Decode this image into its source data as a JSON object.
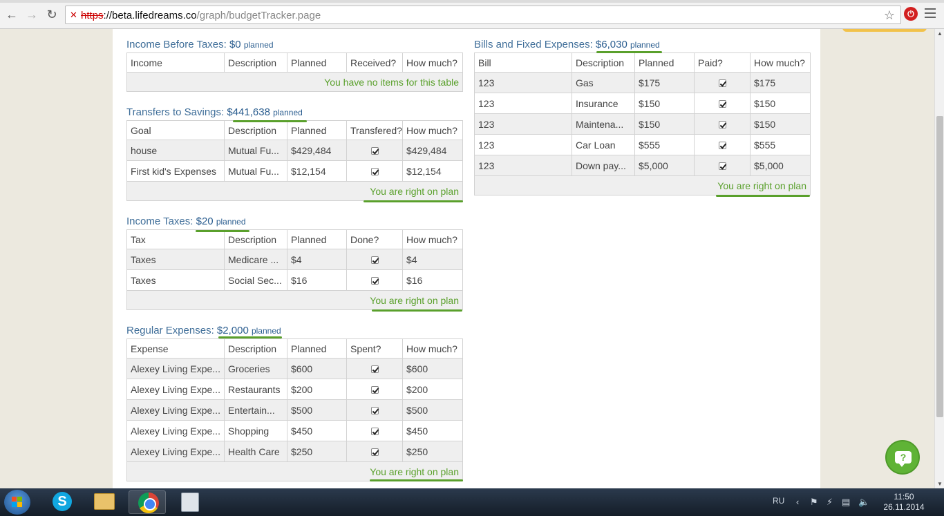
{
  "browser": {
    "url_scheme": "https",
    "url_host": "://beta.lifedreams.co",
    "url_path": "/graph/budgetTracker.page"
  },
  "sections": {
    "income": {
      "title": "Income Before Taxes: ",
      "amount": "$0",
      "planned": "planned",
      "headers": [
        "Income",
        "Description",
        "Planned",
        "Received?",
        "How much?"
      ],
      "rows": [],
      "footer": "You have no items for this table"
    },
    "savings": {
      "title": "Transfers to Savings: ",
      "amount": "$441,638",
      "planned": "planned",
      "headers": [
        "Goal",
        "Description",
        "Planned",
        "Transfered?",
        "How much?"
      ],
      "rows": [
        {
          "name": "house",
          "description": "Mutual Fu...",
          "planned": "$429,484",
          "checked": true,
          "how_much": "$429,484"
        },
        {
          "name": "First kid's Expenses",
          "description": "Mutual Fu...",
          "planned": "$12,154",
          "checked": true,
          "how_much": "$12,154"
        }
      ],
      "footer": "You are right on plan"
    },
    "taxes": {
      "title": "Income Taxes: ",
      "amount": "$20",
      "planned": "planned",
      "headers": [
        "Tax",
        "Description",
        "Planned",
        "Done?",
        "How much?"
      ],
      "rows": [
        {
          "name": "Taxes",
          "description": "Medicare ...",
          "planned": "$4",
          "checked": true,
          "how_much": "$4"
        },
        {
          "name": "Taxes",
          "description": "Social Sec...",
          "planned": "$16",
          "checked": true,
          "how_much": "$16"
        }
      ],
      "footer": "You are right on plan"
    },
    "expenses": {
      "title": "Regular Expenses: ",
      "amount": "$2,000",
      "planned": "planned",
      "headers": [
        "Expense",
        "Description",
        "Planned",
        "Spent?",
        "How much?"
      ],
      "rows": [
        {
          "name": "Alexey Living Expe...",
          "description": "Groceries",
          "planned": "$600",
          "checked": true,
          "how_much": "$600"
        },
        {
          "name": "Alexey Living Expe...",
          "description": "Restaurants",
          "planned": "$200",
          "checked": true,
          "how_much": "$200"
        },
        {
          "name": "Alexey Living Expe...",
          "description": "Entertain...",
          "planned": "$500",
          "checked": true,
          "how_much": "$500"
        },
        {
          "name": "Alexey Living Expe...",
          "description": "Shopping",
          "planned": "$450",
          "checked": true,
          "how_much": "$450"
        },
        {
          "name": "Alexey Living Expe...",
          "description": "Health Care",
          "planned": "$250",
          "checked": true,
          "how_much": "$250"
        }
      ],
      "footer": "You are right on plan"
    },
    "bills": {
      "title": "Bills and Fixed Expenses: ",
      "amount": "$6,030",
      "planned": "planned",
      "headers": [
        "Bill",
        "Description",
        "Planned",
        "Paid?",
        "How much?"
      ],
      "rows": [
        {
          "name": "123",
          "description": "Gas",
          "planned": "$175",
          "checked": true,
          "how_much": "$175"
        },
        {
          "name": "123",
          "description": "Insurance",
          "planned": "$150",
          "checked": true,
          "how_much": "$150"
        },
        {
          "name": "123",
          "description": "Maintena...",
          "planned": "$150",
          "checked": true,
          "how_much": "$150"
        },
        {
          "name": "123",
          "description": "Car Loan",
          "planned": "$555",
          "checked": true,
          "how_much": "$555"
        },
        {
          "name": "123",
          "description": "Down pay...",
          "planned": "$5,000",
          "checked": true,
          "how_much": "$5,000"
        }
      ],
      "footer": "You are right on plan"
    }
  },
  "help": {
    "glyph": "?"
  },
  "taskbar": {
    "language": "RU",
    "time": "11:50",
    "date": "26.11.2014"
  },
  "colors": {
    "link": "#3f6e99",
    "ok_green": "#5aa02c",
    "row_alt": "#efefef"
  }
}
